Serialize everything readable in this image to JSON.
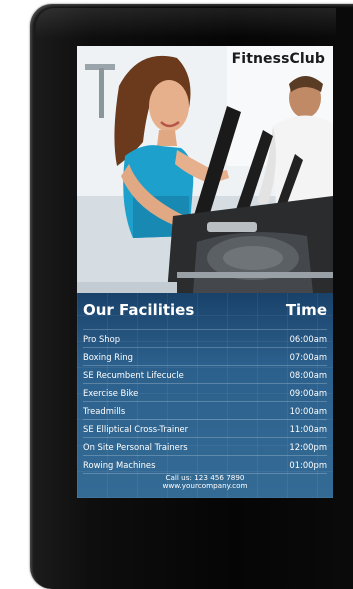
{
  "brand": {
    "name": "FitnessClub"
  },
  "panel": {
    "heading": "Our Facilities",
    "time_heading": "Time"
  },
  "schedule": [
    {
      "facility": "Pro Shop",
      "time": "06:00am"
    },
    {
      "facility": "Boxing Ring",
      "time": "07:00am"
    },
    {
      "facility": "SE Recumbent Lifecucle",
      "time": "08:00am"
    },
    {
      "facility": "Exercise Bike",
      "time": "09:00am"
    },
    {
      "facility": "Treadmills",
      "time": "10:00am"
    },
    {
      "facility": "SE Elliptical Cross-Trainer",
      "time": "11:00am"
    },
    {
      "facility": "On Site Personal Trainers",
      "time": "12:00pm"
    },
    {
      "facility": "Rowing Machines",
      "time": "01:00pm"
    }
  ],
  "footer": {
    "phone_line": "Call us: 123 456 7890",
    "website": "www.yourcompany.com"
  },
  "colors": {
    "panel_blue": "#2d5f8c",
    "bezel_black": "#0b0b0b"
  }
}
